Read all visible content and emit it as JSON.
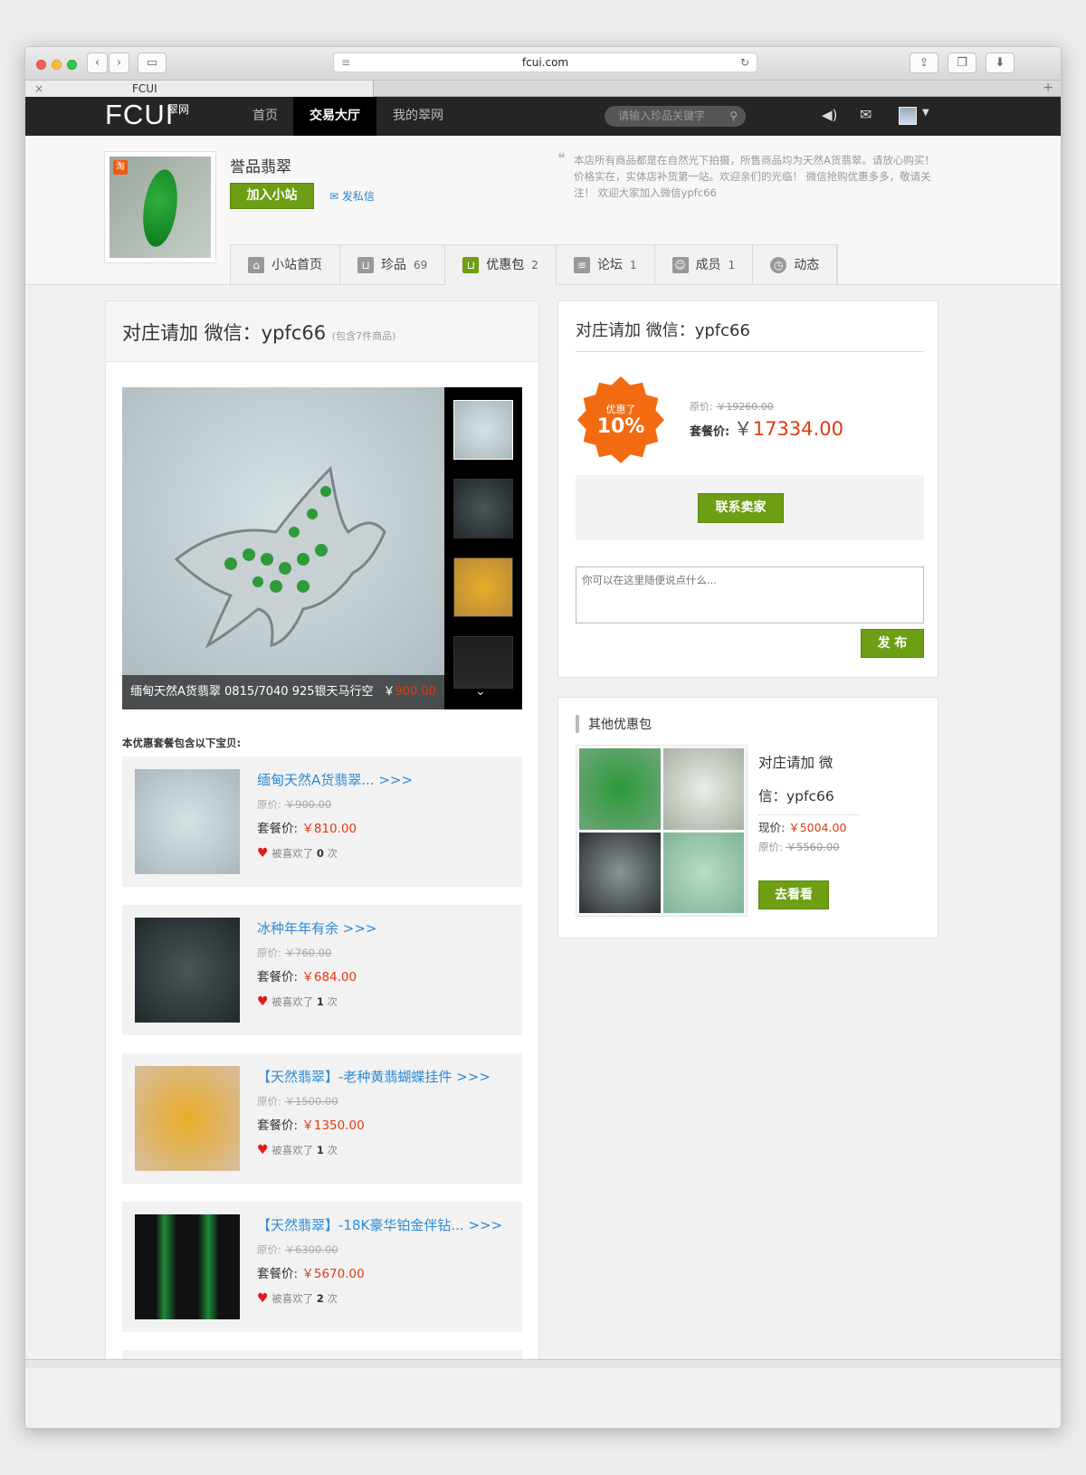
{
  "browser": {
    "url": "fcui.com",
    "tab_title": "FCUI",
    "icons": [
      "close-icon",
      "minimize-icon",
      "zoom-icon",
      "back-icon",
      "forward-icon",
      "sidebar-icon",
      "reader-icon",
      "reload-icon",
      "share-icon",
      "tabs-icon",
      "download-icon",
      "new-tab-icon"
    ]
  },
  "nav": {
    "logo": "FCUI",
    "logo_sub": "翠网",
    "items": [
      "首页",
      "交易大厅",
      "我的翠网"
    ],
    "search_placeholder": "请输入珍品关键字"
  },
  "shop": {
    "name": "誉品翡翠",
    "badge": "淘",
    "join_label": "加入小站",
    "message_label": "发私信",
    "notice": "本店所有商品都是在自然光下拍摄，所售商品均为天然A货翡翠。请放心购买！价格实在，实体店补货第一站。欢迎亲们的光临！ 微信抢购优惠多多，敬请关注！ 欢迎大家加入微信ypfc66",
    "tabs": [
      {
        "label": "小站首页",
        "count": ""
      },
      {
        "label": "珍品",
        "count": "69"
      },
      {
        "label": "优惠包",
        "count": "2"
      },
      {
        "label": "论坛",
        "count": "1"
      },
      {
        "label": "成员",
        "count": "1"
      },
      {
        "label": "动态",
        "count": ""
      }
    ]
  },
  "package": {
    "title": "对庄请加 微信：ypfc66",
    "subtitle": "(包含7件商品)",
    "caption_name": "缅甸天然A货翡翠 0815/7040 925银天马行空",
    "caption_price_prefix": "￥",
    "caption_price": "900.00",
    "includes_label": "本优惠套餐包含以下宝贝:",
    "items": [
      {
        "title": "缅甸天然A货翡翠... >>>",
        "orig_label": "原价:",
        "orig": "￥900.00",
        "pkg_label": "套餐价:",
        "pkg": "￥810.00",
        "like_label": "被喜欢了",
        "likes": "0",
        "like_unit": "次"
      },
      {
        "title": "冰种年年有余 >>>",
        "orig_label": "原价:",
        "orig": "￥760.00",
        "pkg_label": "套餐价:",
        "pkg": "￥684.00",
        "like_label": "被喜欢了",
        "likes": "1",
        "like_unit": "次"
      },
      {
        "title": "【天然翡翠】-老种黄翡蝴蝶挂件 >>>",
        "orig_label": "原价:",
        "orig": "￥1500.00",
        "pkg_label": "套餐价:",
        "pkg": "￥1350.00",
        "like_label": "被喜欢了",
        "likes": "1",
        "like_unit": "次"
      },
      {
        "title": "【天然翡翠】-18K豪华铂金伴钻... >>>",
        "orig_label": "原价:",
        "orig": "￥6300.00",
        "pkg_label": "套餐价:",
        "pkg": "￥5670.00",
        "like_label": "被喜欢了",
        "likes": "2",
        "like_unit": "次"
      }
    ]
  },
  "summary": {
    "title": "对庄请加 微信：ypfc66",
    "discount_label": "优惠了",
    "discount": "10%",
    "orig_label": "原价:",
    "orig": "￥19260.00",
    "pkg_label": "套餐价:",
    "pkg_prefix": "￥",
    "pkg": "17334.00",
    "contact_label": "联系卖家",
    "comment_placeholder": "你可以在这里随便说点什么...",
    "publish_label": "发 布"
  },
  "others": {
    "title": "其他优惠包",
    "name": "对庄请加 微信：ypfc66",
    "now_label": "现价:",
    "now": "￥5004.00",
    "orig_label": "原价:",
    "orig": "￥5560.00",
    "go_label": "去看看"
  },
  "colors": {
    "accent_green": "#6d9e13",
    "price_red": "#e23a10",
    "link_blue": "#2e8ad6",
    "nav_dark": "#252525",
    "burst_orange": "#f26b11"
  }
}
